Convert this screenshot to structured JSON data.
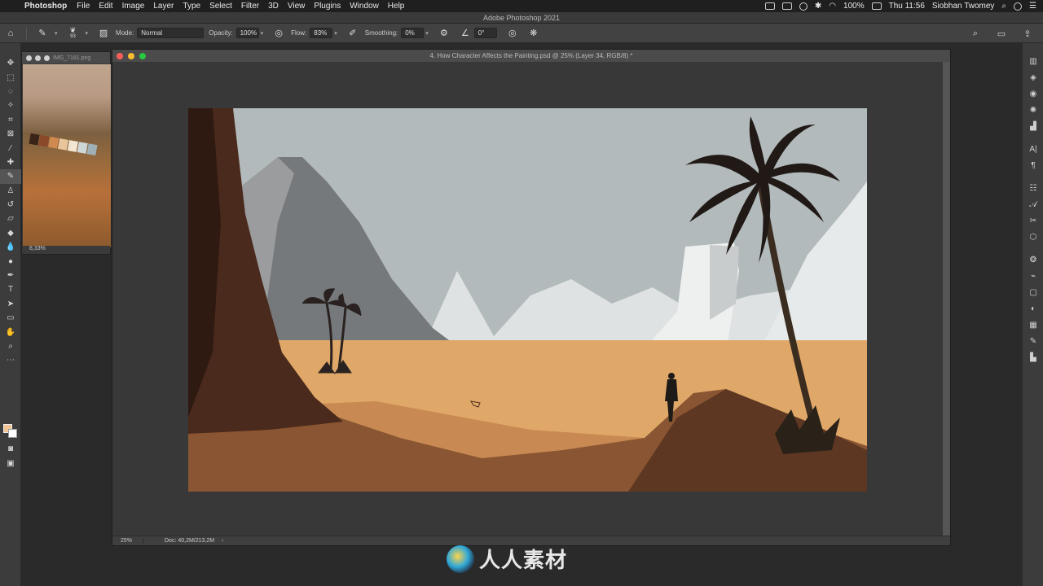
{
  "menubar": {
    "app_name": "Photoshop",
    "items": [
      "File",
      "Edit",
      "Image",
      "Layer",
      "Type",
      "Select",
      "Filter",
      "3D",
      "View",
      "Plugins",
      "Window",
      "Help"
    ],
    "battery": "100%",
    "clock": "Thu 11:56",
    "user": "Siobhan Twomey"
  },
  "app_title": "Adobe Photoshop 2021",
  "options": {
    "brush_size": "93",
    "mode_label": "Mode:",
    "mode_value": "Normal",
    "opacity_label": "Opacity:",
    "opacity_value": "100%",
    "flow_label": "Flow:",
    "flow_value": "83%",
    "smoothing_label": "Smoothing:",
    "smoothing_value": "0%",
    "angle_value": "0°"
  },
  "tools": [
    "move-tool",
    "marquee-tool",
    "lasso-tool",
    "quick-select-tool",
    "crop-tool",
    "frame-tool",
    "eyedropper-tool",
    "healing-tool",
    "brush-tool",
    "stamp-tool",
    "history-brush-tool",
    "eraser-tool",
    "gradient-tool",
    "blur-tool",
    "dodge-tool",
    "pen-tool",
    "type-tool",
    "path-select-tool",
    "shape-tool",
    "hand-tool",
    "zoom-tool",
    "more-tools"
  ],
  "reference_window": {
    "title": "IMG_7181.png",
    "zoom": "8,33%"
  },
  "document": {
    "title": "4. How Character Affects the Painting.psd @ 25% (Layer 34, RGB/8) *",
    "zoom": "25%",
    "doc_size": "Doc: 40,2M/213,2M"
  },
  "colors": {
    "foreground": "#f2c494",
    "background": "#ffffff",
    "sky": "#b3babb",
    "sand": "#e0a868",
    "cliff": "#4a2a1c"
  },
  "watermark": {
    "text": "人人素材"
  }
}
